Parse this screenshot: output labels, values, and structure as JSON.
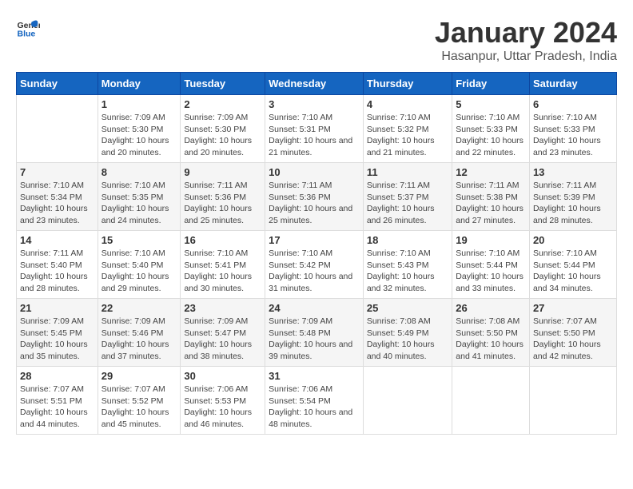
{
  "header": {
    "logo_general": "General",
    "logo_blue": "Blue",
    "title": "January 2024",
    "subtitle": "Hasanpur, Uttar Pradesh, India"
  },
  "calendar": {
    "days_of_week": [
      "Sunday",
      "Monday",
      "Tuesday",
      "Wednesday",
      "Thursday",
      "Friday",
      "Saturday"
    ],
    "weeks": [
      [
        {
          "day": "",
          "info": ""
        },
        {
          "day": "1",
          "info": "Sunrise: 7:09 AM\nSunset: 5:30 PM\nDaylight: 10 hours\nand 20 minutes."
        },
        {
          "day": "2",
          "info": "Sunrise: 7:09 AM\nSunset: 5:30 PM\nDaylight: 10 hours\nand 20 minutes."
        },
        {
          "day": "3",
          "info": "Sunrise: 7:10 AM\nSunset: 5:31 PM\nDaylight: 10 hours\nand 21 minutes."
        },
        {
          "day": "4",
          "info": "Sunrise: 7:10 AM\nSunset: 5:32 PM\nDaylight: 10 hours\nand 21 minutes."
        },
        {
          "day": "5",
          "info": "Sunrise: 7:10 AM\nSunset: 5:33 PM\nDaylight: 10 hours\nand 22 minutes."
        },
        {
          "day": "6",
          "info": "Sunrise: 7:10 AM\nSunset: 5:33 PM\nDaylight: 10 hours\nand 23 minutes."
        }
      ],
      [
        {
          "day": "7",
          "info": "Sunrise: 7:10 AM\nSunset: 5:34 PM\nDaylight: 10 hours\nand 23 minutes."
        },
        {
          "day": "8",
          "info": "Sunrise: 7:10 AM\nSunset: 5:35 PM\nDaylight: 10 hours\nand 24 minutes."
        },
        {
          "day": "9",
          "info": "Sunrise: 7:11 AM\nSunset: 5:36 PM\nDaylight: 10 hours\nand 25 minutes."
        },
        {
          "day": "10",
          "info": "Sunrise: 7:11 AM\nSunset: 5:36 PM\nDaylight: 10 hours\nand 25 minutes."
        },
        {
          "day": "11",
          "info": "Sunrise: 7:11 AM\nSunset: 5:37 PM\nDaylight: 10 hours\nand 26 minutes."
        },
        {
          "day": "12",
          "info": "Sunrise: 7:11 AM\nSunset: 5:38 PM\nDaylight: 10 hours\nand 27 minutes."
        },
        {
          "day": "13",
          "info": "Sunrise: 7:11 AM\nSunset: 5:39 PM\nDaylight: 10 hours\nand 28 minutes."
        }
      ],
      [
        {
          "day": "14",
          "info": "Sunrise: 7:11 AM\nSunset: 5:40 PM\nDaylight: 10 hours\nand 28 minutes."
        },
        {
          "day": "15",
          "info": "Sunrise: 7:10 AM\nSunset: 5:40 PM\nDaylight: 10 hours\nand 29 minutes."
        },
        {
          "day": "16",
          "info": "Sunrise: 7:10 AM\nSunset: 5:41 PM\nDaylight: 10 hours\nand 30 minutes."
        },
        {
          "day": "17",
          "info": "Sunrise: 7:10 AM\nSunset: 5:42 PM\nDaylight: 10 hours\nand 31 minutes."
        },
        {
          "day": "18",
          "info": "Sunrise: 7:10 AM\nSunset: 5:43 PM\nDaylight: 10 hours\nand 32 minutes."
        },
        {
          "day": "19",
          "info": "Sunrise: 7:10 AM\nSunset: 5:44 PM\nDaylight: 10 hours\nand 33 minutes."
        },
        {
          "day": "20",
          "info": "Sunrise: 7:10 AM\nSunset: 5:44 PM\nDaylight: 10 hours\nand 34 minutes."
        }
      ],
      [
        {
          "day": "21",
          "info": "Sunrise: 7:09 AM\nSunset: 5:45 PM\nDaylight: 10 hours\nand 35 minutes."
        },
        {
          "day": "22",
          "info": "Sunrise: 7:09 AM\nSunset: 5:46 PM\nDaylight: 10 hours\nand 37 minutes."
        },
        {
          "day": "23",
          "info": "Sunrise: 7:09 AM\nSunset: 5:47 PM\nDaylight: 10 hours\nand 38 minutes."
        },
        {
          "day": "24",
          "info": "Sunrise: 7:09 AM\nSunset: 5:48 PM\nDaylight: 10 hours\nand 39 minutes."
        },
        {
          "day": "25",
          "info": "Sunrise: 7:08 AM\nSunset: 5:49 PM\nDaylight: 10 hours\nand 40 minutes."
        },
        {
          "day": "26",
          "info": "Sunrise: 7:08 AM\nSunset: 5:50 PM\nDaylight: 10 hours\nand 41 minutes."
        },
        {
          "day": "27",
          "info": "Sunrise: 7:07 AM\nSunset: 5:50 PM\nDaylight: 10 hours\nand 42 minutes."
        }
      ],
      [
        {
          "day": "28",
          "info": "Sunrise: 7:07 AM\nSunset: 5:51 PM\nDaylight: 10 hours\nand 44 minutes."
        },
        {
          "day": "29",
          "info": "Sunrise: 7:07 AM\nSunset: 5:52 PM\nDaylight: 10 hours\nand 45 minutes."
        },
        {
          "day": "30",
          "info": "Sunrise: 7:06 AM\nSunset: 5:53 PM\nDaylight: 10 hours\nand 46 minutes."
        },
        {
          "day": "31",
          "info": "Sunrise: 7:06 AM\nSunset: 5:54 PM\nDaylight: 10 hours\nand 48 minutes."
        },
        {
          "day": "",
          "info": ""
        },
        {
          "day": "",
          "info": ""
        },
        {
          "day": "",
          "info": ""
        }
      ]
    ]
  }
}
